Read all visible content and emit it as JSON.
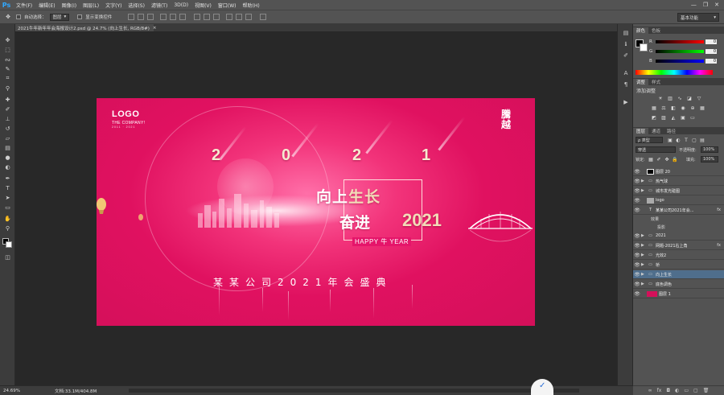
{
  "app": {
    "logo": "Ps"
  },
  "menubar": {
    "items": [
      "文件(F)",
      "编辑(E)",
      "图像(I)",
      "图层(L)",
      "文字(Y)",
      "选择(S)",
      "滤镜(T)",
      "3D(D)",
      "视图(V)",
      "窗口(W)",
      "帮助(H)"
    ],
    "minimize": "—",
    "restore": "❐",
    "close": "✕"
  },
  "options": {
    "auto_select_label": "自动选择：",
    "auto_select_value": "图层",
    "show_transform_label": "显示变换控件",
    "workspace": "基本功能"
  },
  "document": {
    "tab_title": "2021牛年新年年会海报设计2.psd @ 24.7% (向上生长, RGB/8#)",
    "tab_close": "×"
  },
  "artwork": {
    "logo": "LOGO",
    "company": "THE COMPANY!",
    "company_years": "2011 · 2021",
    "stamp_line1": "騰",
    "stamp_line2": "越",
    "year_digits": [
      "2",
      "0",
      "2",
      "1"
    ],
    "slogan1_a": "向上",
    "slogan1_b": "生长",
    "slogan2_cn": "奋进",
    "slogan2_year": "2021",
    "happy": "HAPPY 牛 YEAR",
    "subtitle": "某某公司2021年会盛典"
  },
  "panels": {
    "color_tabs": [
      "颜色",
      "色板"
    ],
    "sliders": [
      {
        "label": "R",
        "value": "0",
        "color_from": "#000000",
        "color_to": "#ff0000"
      },
      {
        "label": "G",
        "value": "0",
        "color_from": "#000000",
        "color_to": "#00ff00"
      },
      {
        "label": "B",
        "value": "0",
        "color_from": "#000000",
        "color_to": "#0000ff"
      }
    ],
    "adjust_tabs": [
      "调整",
      "样式"
    ],
    "adjust_title": "添加调整",
    "layers_tabs": [
      "图层",
      "通道",
      "路径"
    ],
    "filter_kind": "ρ 类型",
    "blend_mode": "穿透",
    "opacity_label": "不透明度:",
    "opacity_value": "100%",
    "lock_label": "锁定:",
    "fill_label": "填充:",
    "fill_value": "100%"
  },
  "layers": [
    {
      "name": "图层 20",
      "type": "mask",
      "fx": "",
      "selected": false
    },
    {
      "name": "热气球",
      "type": "folder",
      "fx": "",
      "selected": false
    },
    {
      "name": "城市发光碰图",
      "type": "folder",
      "fx": "",
      "selected": false
    },
    {
      "name": "logo",
      "type": "image",
      "fx": "",
      "selected": false
    },
    {
      "name": "某某公司2021年会...",
      "type": "text",
      "fx": "fx",
      "selected": false
    },
    {
      "name": "2021",
      "type": "folder",
      "fx": "",
      "selected": false
    },
    {
      "name": "网题-2021右上角",
      "type": "folder",
      "fx": "fx",
      "selected": false
    },
    {
      "name": "光效2",
      "type": "folder",
      "fx": "",
      "selected": false
    },
    {
      "name": "桥",
      "type": "folder",
      "fx": "",
      "selected": false
    },
    {
      "name": "向上生长",
      "type": "folder",
      "fx": "",
      "selected": true
    },
    {
      "name": "底色调色",
      "type": "folder",
      "fx": "",
      "selected": false
    },
    {
      "name": "图层 1",
      "type": "fill",
      "fx": "",
      "selected": false
    }
  ],
  "layer_effects": {
    "label": "效果",
    "item": "投影"
  },
  "status": {
    "zoom": "24.69%",
    "doc_size": "文档:33.1M/404.8M"
  },
  "colors": {
    "app_bg": "#535353",
    "canvas_bg": "#282828",
    "poster_pink": "#e01160",
    "gold": "#f2dcb8",
    "selected_layer": "#4f6e8c"
  }
}
